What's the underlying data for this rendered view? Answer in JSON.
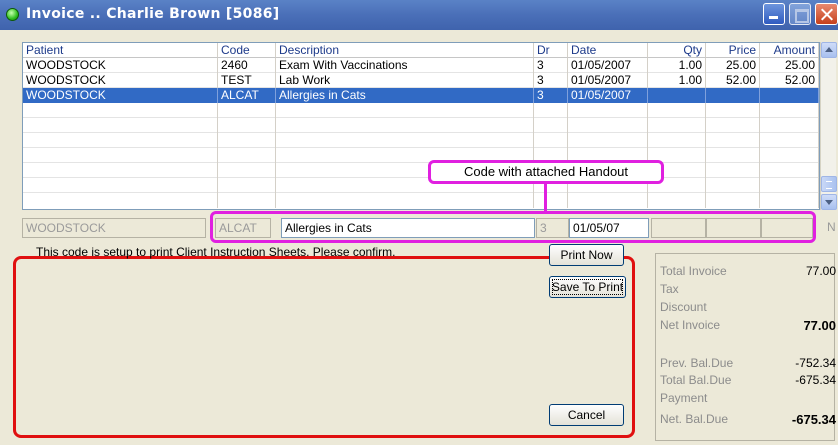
{
  "window": {
    "title": "Invoice .. Charlie Brown  [5086]"
  },
  "grid": {
    "headers": {
      "patient": "Patient",
      "code": "Code",
      "description": "Description",
      "dr": "Dr",
      "date": "Date",
      "qty": "Qty",
      "price": "Price",
      "amount": "Amount"
    },
    "rows": [
      {
        "patient": "WOODSTOCK",
        "code": "2460",
        "description": "Exam With Vaccinations",
        "dr": "3",
        "date": "01/05/2007",
        "qty": "1.00",
        "price": "25.00",
        "amount": "25.00"
      },
      {
        "patient": "WOODSTOCK",
        "code": "TEST",
        "description": "Lab Work",
        "dr": "3",
        "date": "01/05/2007",
        "qty": "1.00",
        "price": "52.00",
        "amount": "52.00"
      },
      {
        "patient": "WOODSTOCK",
        "code": "ALCAT",
        "description": "Allergies in Cats",
        "dr": "3",
        "date": "01/05/2007",
        "qty": "",
        "price": "",
        "amount": ""
      }
    ],
    "selected_row": 3
  },
  "callout": {
    "text": "Code with attached Handout"
  },
  "edit_row": {
    "patient": "WOODSTOCK",
    "code": "ALCAT",
    "description": "Allergies in Cats",
    "dr": "3",
    "date": "01/05/07",
    "trailing": "N"
  },
  "confirm": {
    "message": "This code is setup to print Client Instruction Sheets. Please confirm.",
    "print_now": "Print Now",
    "save_to_print": "Save To Print",
    "cancel": "Cancel"
  },
  "totals": {
    "total_invoice": {
      "label": "Total Invoice",
      "value": "77.00"
    },
    "tax": {
      "label": "Tax",
      "value": ""
    },
    "discount": {
      "label": "Discount",
      "value": ""
    },
    "net_invoice": {
      "label": "Net Invoice",
      "value": "77.00"
    },
    "prev_bal_due": {
      "label": "Prev. Bal.Due",
      "value": "-752.34"
    },
    "total_bal_due": {
      "label": "Total Bal.Due",
      "value": "-675.34"
    },
    "payment": {
      "label": "Payment",
      "value": ""
    },
    "net_bal_due": {
      "label": "Net. Bal.Due",
      "value": "-675.34"
    }
  },
  "colors": {
    "title_bar": "#4a6fb8",
    "selection": "#316ac5",
    "callout_border": "#e020e0",
    "confirm_border": "#e01010"
  }
}
